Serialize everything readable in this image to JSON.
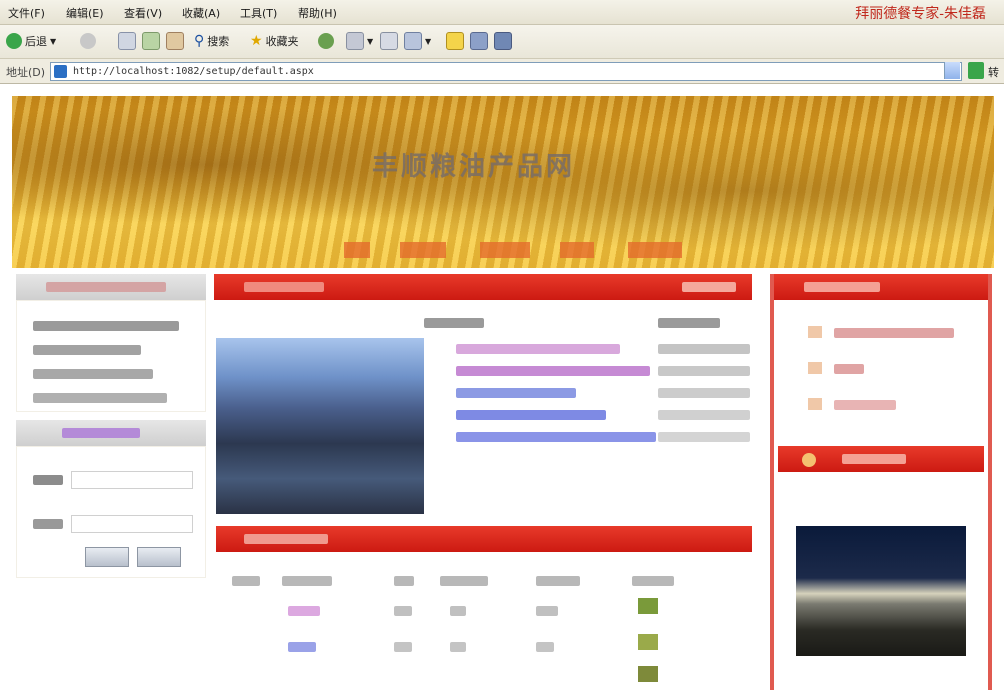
{
  "menu": {
    "items": [
      "文件(F)",
      "编辑(E)",
      "查看(V)",
      "收藏(A)",
      "工具(T)",
      "帮助(H)"
    ],
    "brand": "拜丽德餐专家-朱佳磊"
  },
  "toolbar": {
    "back_label": "后退",
    "search_label": "搜索",
    "favorites_label": "收藏夹"
  },
  "address": {
    "label": "地址(D)",
    "url": "http://localhost:1082/setup/default.aspx",
    "go_label": "转"
  },
  "page": {
    "banner_title": "丰顺粮油产品网"
  },
  "colors": {
    "accent_red": "#d4241a",
    "banner_gold": "#e9b22c"
  }
}
